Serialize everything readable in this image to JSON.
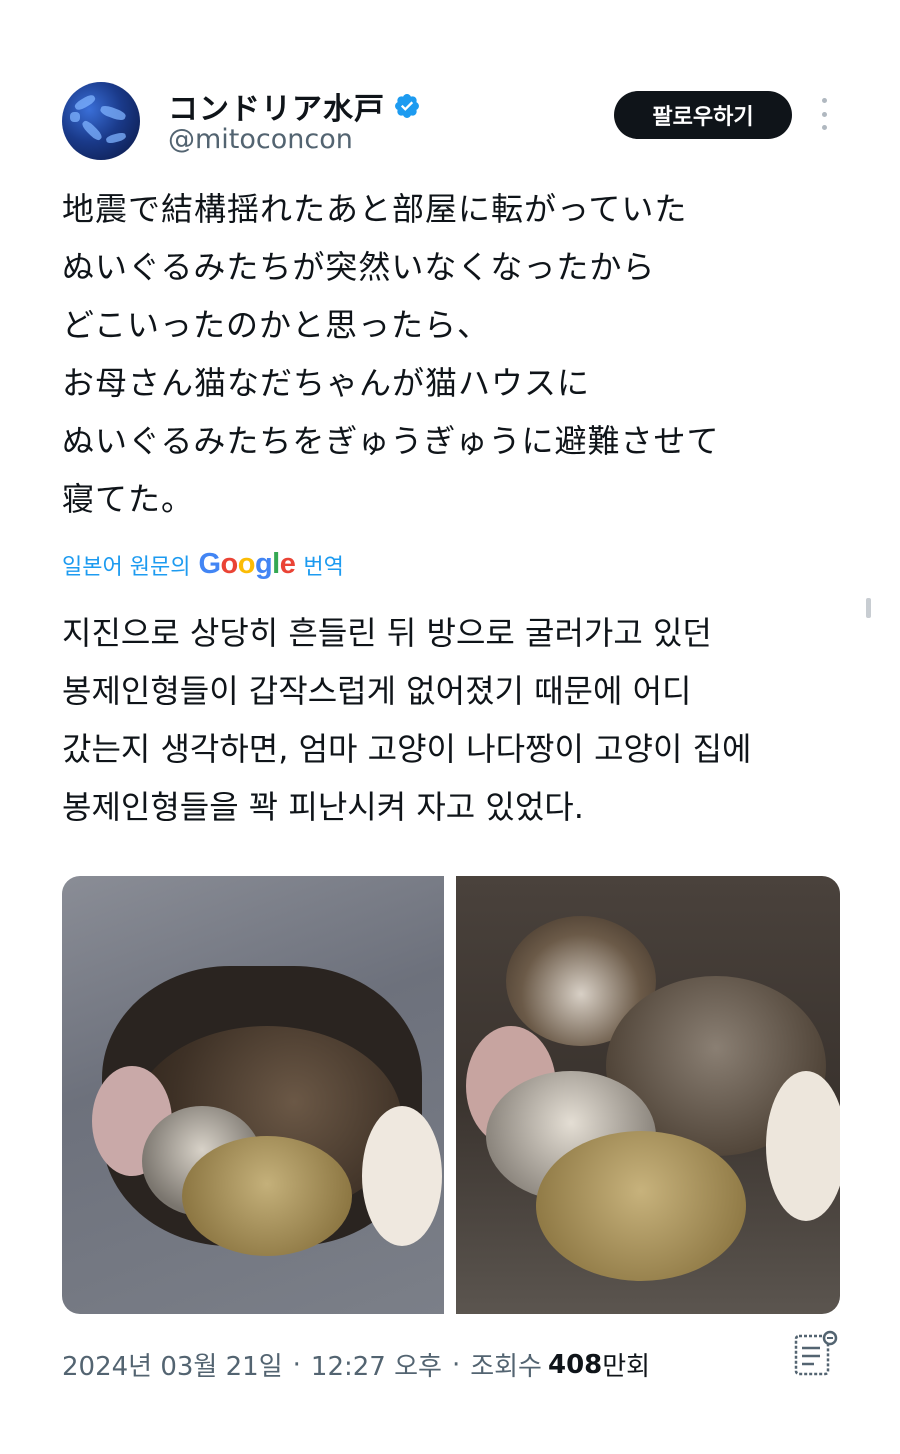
{
  "author": {
    "display_name": "コンドリア水戸",
    "handle": "@mitoconcon",
    "avatar_icon": "avatar-image",
    "verified_icon": "verified-badge-icon",
    "verified_color": "#1d9bf0"
  },
  "header": {
    "follow_label": "팔로우하기",
    "more_icon": "more-vertical-icon"
  },
  "tweet": {
    "original_text": "地震で結構揺れたあと部屋に転がっていた\nぬいぐるみたちが突然いなくなったから\nどこいったのかと思ったら、\nお母さん猫なだちゃんが猫ハウスに\nぬいぐるみたちをぎゅうぎゅうに避難させて\n寝てた。",
    "translation_prefix": "일본어 원문의",
    "translation_provider": "Google",
    "translation_suffix": "번역",
    "translated_text": "지진으로 상당히 흔들린 뒤 방으로 굴러가고 있던\n봉제인형들이 갑작스럽게 없어졌기 때문에 어디\n갔는지 생각하면, 엄마 고양이 나다짱이 고양이 집에\n봉제인형들을 꽉 피난시켜 자고 있었다."
  },
  "media": [
    {
      "name": "photo-cat-sleeping"
    },
    {
      "name": "photo-cat-awake"
    }
  ],
  "meta": {
    "date": "2024년 03월 21일",
    "time": "12:27 오후",
    "views_label": "조회수",
    "views_count": "408",
    "views_unit": "만회",
    "notes_icon": "community-notes-icon"
  },
  "colors": {
    "link": "#1d9bf0",
    "muted": "#536471",
    "text": "#0f1419",
    "button_bg": "#0f1419"
  }
}
